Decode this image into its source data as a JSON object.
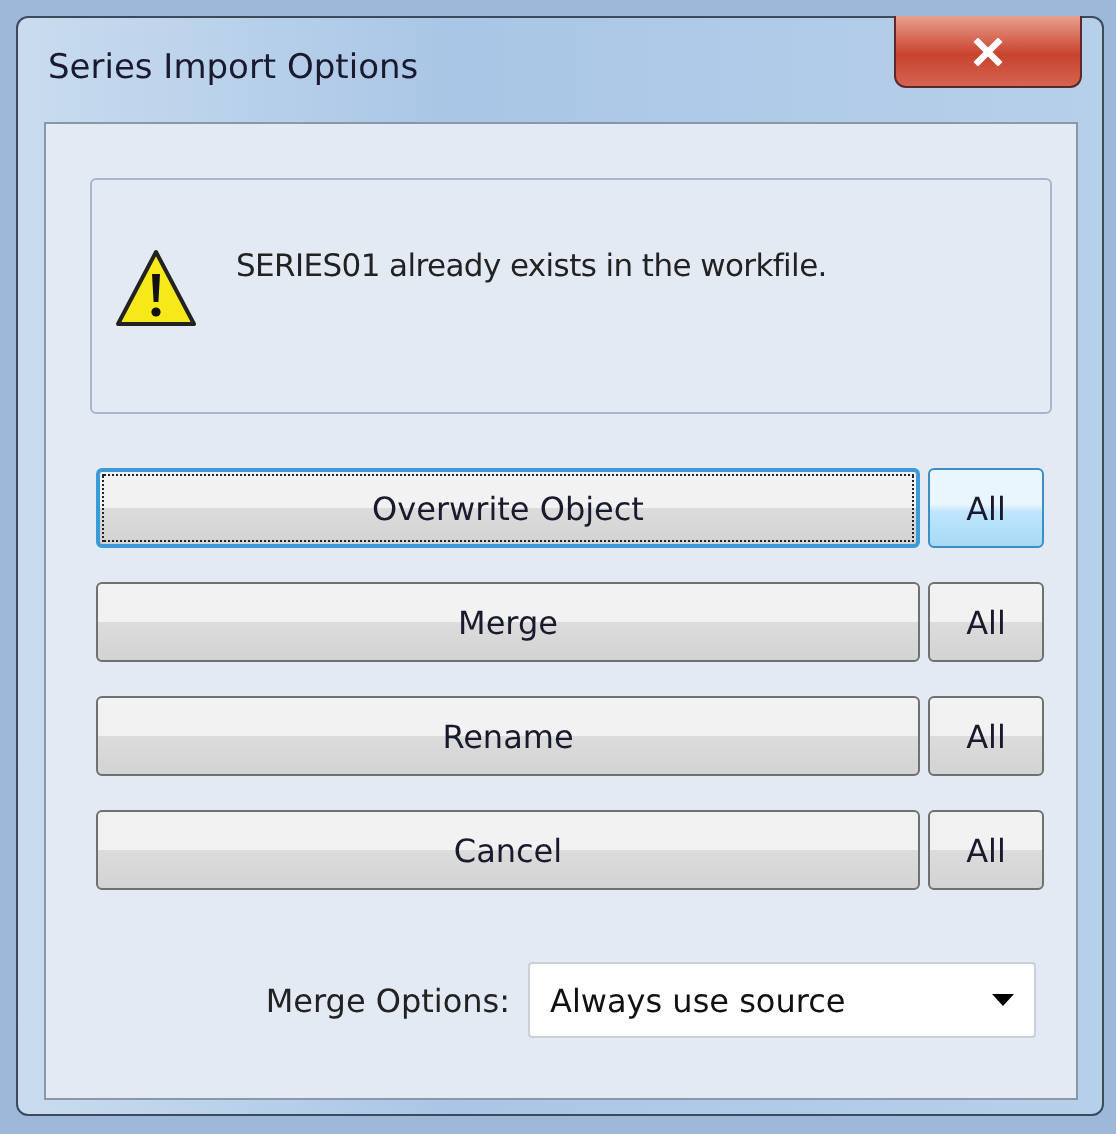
{
  "window": {
    "title": "Series Import Options"
  },
  "message": "SERIES01 already exists in the workfile.",
  "actions": [
    {
      "label": "Overwrite Object",
      "focused": true,
      "all_label": "All",
      "all_highlighted": true
    },
    {
      "label": "Merge",
      "focused": false,
      "all_label": "All",
      "all_highlighted": false
    },
    {
      "label": "Rename",
      "focused": false,
      "all_label": "All",
      "all_highlighted": false
    },
    {
      "label": "Cancel",
      "focused": false,
      "all_label": "All",
      "all_highlighted": false
    }
  ],
  "merge_options": {
    "label": "Merge Options:",
    "value": "Always use source"
  }
}
